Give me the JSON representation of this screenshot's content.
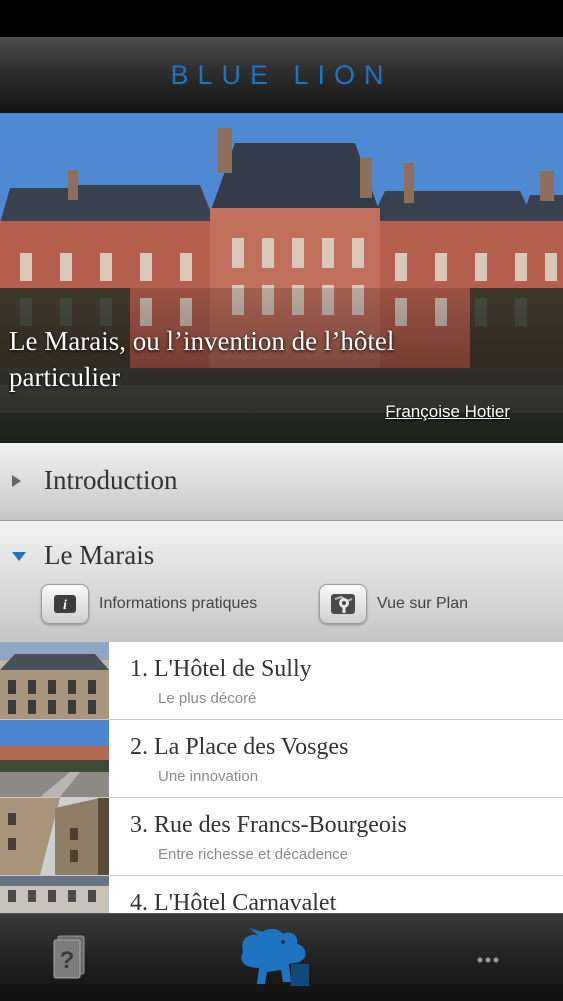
{
  "header": {
    "brand": "BLUE LION"
  },
  "hero": {
    "title": "Le Marais, ou l’invention de l’hôtel particulier",
    "author": "Françoise Hotier"
  },
  "sections": [
    {
      "title": "Introduction",
      "expanded": false
    },
    {
      "title": "Le Marais",
      "expanded": true,
      "actions": [
        {
          "label": "Informations pratiques",
          "icon": "info-icon"
        },
        {
          "label": "Vue sur Plan",
          "icon": "map-icon"
        }
      ]
    }
  ],
  "list": [
    {
      "title": "1. L'Hôtel de Sully",
      "subtitle": "Le plus décoré"
    },
    {
      "title": "2. La Place des Vosges",
      "subtitle": "Une innovation"
    },
    {
      "title": "3. Rue des Francs-Bourgeois",
      "subtitle": "Entre richesse et décadence"
    },
    {
      "title": "4. L'Hôtel Carnavalet",
      "subtitle": ""
    }
  ],
  "tabbar": {
    "left_icon": "help-card-icon",
    "center_icon": "lion-logo-icon",
    "right_icon": "more-icon"
  },
  "colors": {
    "accent": "#1f74c2",
    "header_bg": "#2e2e2e"
  }
}
